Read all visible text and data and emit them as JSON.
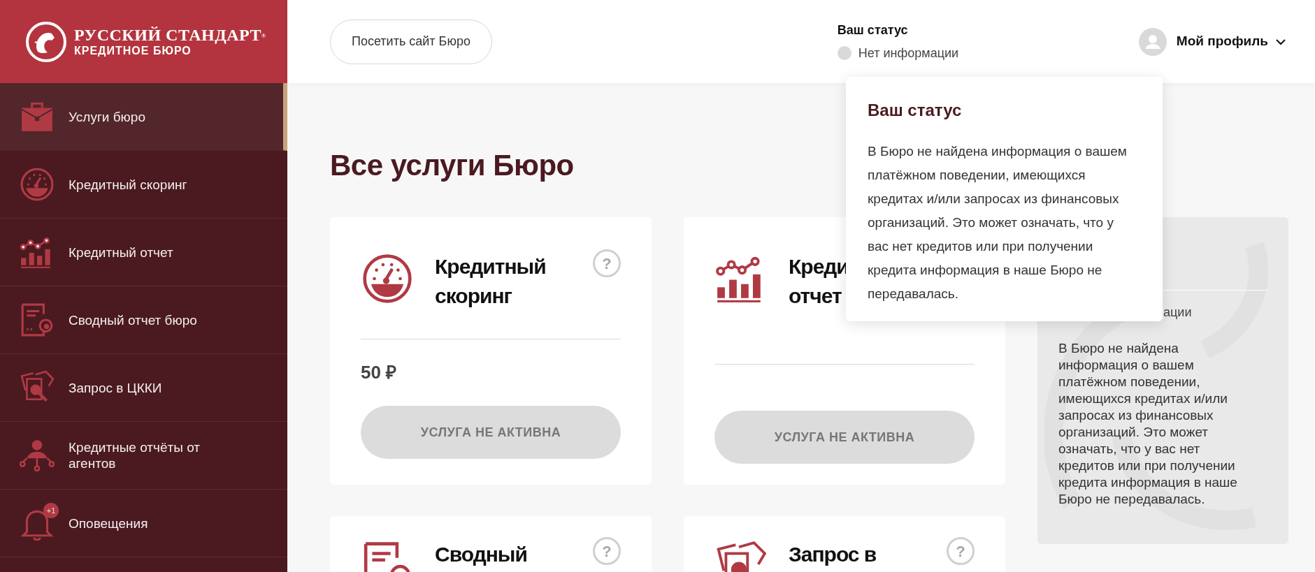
{
  "logo": {
    "title": "РУССКИЙ СТАНДАРТ",
    "registered_mark": "®",
    "subtitle": "КРЕДИТНОЕ БЮРО"
  },
  "sidebar": {
    "items": [
      {
        "kind": "briefcase",
        "label": "Услуги бюро",
        "selected": true
      },
      {
        "kind": "gauge",
        "label": "Кредитный скоринг",
        "selected": false
      },
      {
        "kind": "chart",
        "label": "Кредитный отчет",
        "selected": false
      },
      {
        "kind": "document",
        "label": "Сводный отчет бюро",
        "selected": false
      },
      {
        "kind": "inspect",
        "label": "Запрос в ЦККИ",
        "selected": false
      },
      {
        "kind": "agents",
        "label": "Кредитные отчёты от агентов",
        "selected": false
      },
      {
        "kind": "bell",
        "label": "Оповещения",
        "selected": false,
        "badge": "+1"
      }
    ]
  },
  "header": {
    "visit_button": "Посетить сайт Бюро",
    "status_label": "Ваш статус",
    "status_value": "Нет информации",
    "profile": "Мой профиль"
  },
  "popup": {
    "title": "Ваш статус",
    "text": "В Бюро не найдена информация о вашем платёжном поведении, имеющихся кредитах и/или запросах из финансовых организаций. Это может означать, что у вас нет кредитов или при получении кредита информация в наше Бюро не передавалась."
  },
  "page_title": "Все услуги Бюро",
  "cards": [
    {
      "kind": "gauge",
      "help": "?",
      "title_lines": [
        "Кредитный",
        "скоринг"
      ],
      "price": "50 ₽",
      "button": {
        "label": "УСЛУГА НЕ АКТИВНА",
        "disabled": true
      }
    },
    {
      "kind": "chart",
      "title_lines": [
        "Креди",
        "отчет"
      ],
      "button": {
        "label": "УСЛУГА НЕ АКТИВНА",
        "disabled": true
      }
    },
    {
      "kind": "document",
      "help": "?",
      "title_lines": [
        "Сводный"
      ]
    },
    {
      "kind": "inspect",
      "help": "?",
      "title_lines": [
        "Запрос в"
      ]
    }
  ],
  "status_panel": {
    "status_fragment": "ации",
    "text": "В Бюро не найдена информация о вашем платёжном поведении, имеющихся кредитах и/или запросах из финансовых организаций. Это может означать, что у вас нет кредитов или при получении кредита информация в наше Бюро не передавалась."
  }
}
